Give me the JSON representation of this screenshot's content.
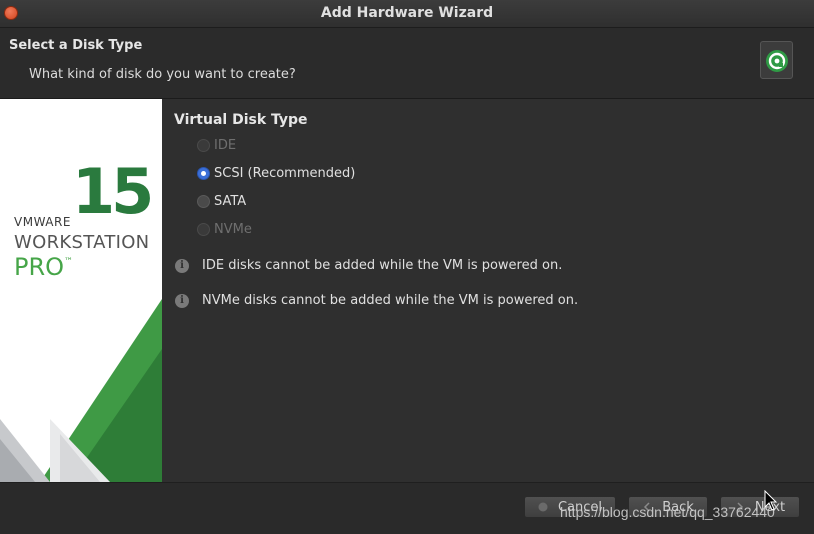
{
  "window": {
    "title": "Add Hardware Wizard"
  },
  "header": {
    "title": "Select a Disk Type",
    "subtitle": "What kind of disk do you want to create?"
  },
  "branding": {
    "version": "15",
    "brand": "VMWARE",
    "product": "WORKSTATION",
    "edition": "PRO",
    "trademark": "™"
  },
  "disk_type": {
    "title": "Virtual Disk Type",
    "options": [
      {
        "label": "IDE",
        "state": "disabled"
      },
      {
        "label": "SCSI (Recommended)",
        "state": "selected"
      },
      {
        "label": "SATA",
        "state": "unselected"
      },
      {
        "label": "NVMe",
        "state": "disabled"
      }
    ]
  },
  "notices": [
    "IDE disks cannot be added while the VM is powered on.",
    "NVMe disks cannot be added while the VM is powered on."
  ],
  "footer": {
    "cancel_label": "Cancel",
    "back_label": "Back",
    "next_label": "Next"
  },
  "watermark": "https://blog.csdn.net/qq_33762440",
  "colors": {
    "accent_green": "#46a548",
    "dark_green": "#2a7a3e",
    "radio_selected": "#3b6fd8",
    "close_button": "#d2451f"
  }
}
